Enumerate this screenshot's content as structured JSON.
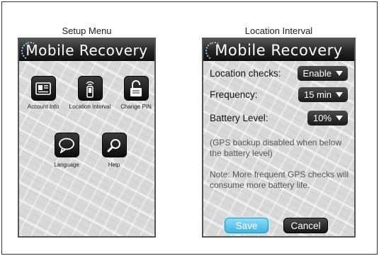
{
  "left_screen": {
    "caption": "Setup Menu",
    "title": "Mobile Recovery",
    "icons": [
      {
        "label": "Account Info",
        "icon": "contact-card-icon"
      },
      {
        "label": "Location Interval",
        "icon": "phone-signal-icon"
      },
      {
        "label": "Change PIN",
        "icon": "unlock-icon"
      },
      {
        "label": "Language",
        "icon": "speech-bubble-icon"
      },
      {
        "label": "Help",
        "icon": "magnifier-icon"
      }
    ]
  },
  "right_screen": {
    "caption": "Location Interval",
    "title": "Mobile Recovery",
    "location_checks": {
      "label": "Location checks:",
      "value": "Enable"
    },
    "frequency": {
      "label": "Frequency:",
      "value": "15 min"
    },
    "battery_level": {
      "label": "Battery Level:",
      "value": "10%"
    },
    "gps_note": "(GPS backup disabled when below the battery level)",
    "info_note": "Note: More frequent GPS checks will consume more battery life.",
    "save_label": "Save",
    "cancel_label": "Cancel"
  },
  "colors": {
    "save_accent": "#42b3e0",
    "banner_dark": "#1a1a1a"
  }
}
